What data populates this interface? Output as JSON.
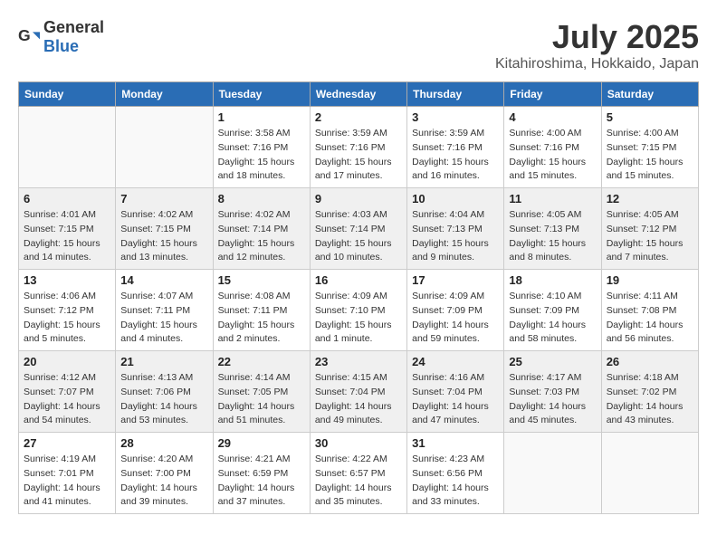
{
  "header": {
    "logo_general": "General",
    "logo_blue": "Blue",
    "month_title": "July 2025",
    "location": "Kitahiroshima, Hokkaido, Japan"
  },
  "weekdays": [
    "Sunday",
    "Monday",
    "Tuesday",
    "Wednesday",
    "Thursday",
    "Friday",
    "Saturday"
  ],
  "weeks": [
    [
      {
        "day": "",
        "detail": ""
      },
      {
        "day": "",
        "detail": ""
      },
      {
        "day": "1",
        "detail": "Sunrise: 3:58 AM\nSunset: 7:16 PM\nDaylight: 15 hours\nand 18 minutes."
      },
      {
        "day": "2",
        "detail": "Sunrise: 3:59 AM\nSunset: 7:16 PM\nDaylight: 15 hours\nand 17 minutes."
      },
      {
        "day": "3",
        "detail": "Sunrise: 3:59 AM\nSunset: 7:16 PM\nDaylight: 15 hours\nand 16 minutes."
      },
      {
        "day": "4",
        "detail": "Sunrise: 4:00 AM\nSunset: 7:16 PM\nDaylight: 15 hours\nand 15 minutes."
      },
      {
        "day": "5",
        "detail": "Sunrise: 4:00 AM\nSunset: 7:15 PM\nDaylight: 15 hours\nand 15 minutes."
      }
    ],
    [
      {
        "day": "6",
        "detail": "Sunrise: 4:01 AM\nSunset: 7:15 PM\nDaylight: 15 hours\nand 14 minutes."
      },
      {
        "day": "7",
        "detail": "Sunrise: 4:02 AM\nSunset: 7:15 PM\nDaylight: 15 hours\nand 13 minutes."
      },
      {
        "day": "8",
        "detail": "Sunrise: 4:02 AM\nSunset: 7:14 PM\nDaylight: 15 hours\nand 12 minutes."
      },
      {
        "day": "9",
        "detail": "Sunrise: 4:03 AM\nSunset: 7:14 PM\nDaylight: 15 hours\nand 10 minutes."
      },
      {
        "day": "10",
        "detail": "Sunrise: 4:04 AM\nSunset: 7:13 PM\nDaylight: 15 hours\nand 9 minutes."
      },
      {
        "day": "11",
        "detail": "Sunrise: 4:05 AM\nSunset: 7:13 PM\nDaylight: 15 hours\nand 8 minutes."
      },
      {
        "day": "12",
        "detail": "Sunrise: 4:05 AM\nSunset: 7:12 PM\nDaylight: 15 hours\nand 7 minutes."
      }
    ],
    [
      {
        "day": "13",
        "detail": "Sunrise: 4:06 AM\nSunset: 7:12 PM\nDaylight: 15 hours\nand 5 minutes."
      },
      {
        "day": "14",
        "detail": "Sunrise: 4:07 AM\nSunset: 7:11 PM\nDaylight: 15 hours\nand 4 minutes."
      },
      {
        "day": "15",
        "detail": "Sunrise: 4:08 AM\nSunset: 7:11 PM\nDaylight: 15 hours\nand 2 minutes."
      },
      {
        "day": "16",
        "detail": "Sunrise: 4:09 AM\nSunset: 7:10 PM\nDaylight: 15 hours\nand 1 minute."
      },
      {
        "day": "17",
        "detail": "Sunrise: 4:09 AM\nSunset: 7:09 PM\nDaylight: 14 hours\nand 59 minutes."
      },
      {
        "day": "18",
        "detail": "Sunrise: 4:10 AM\nSunset: 7:09 PM\nDaylight: 14 hours\nand 58 minutes."
      },
      {
        "day": "19",
        "detail": "Sunrise: 4:11 AM\nSunset: 7:08 PM\nDaylight: 14 hours\nand 56 minutes."
      }
    ],
    [
      {
        "day": "20",
        "detail": "Sunrise: 4:12 AM\nSunset: 7:07 PM\nDaylight: 14 hours\nand 54 minutes."
      },
      {
        "day": "21",
        "detail": "Sunrise: 4:13 AM\nSunset: 7:06 PM\nDaylight: 14 hours\nand 53 minutes."
      },
      {
        "day": "22",
        "detail": "Sunrise: 4:14 AM\nSunset: 7:05 PM\nDaylight: 14 hours\nand 51 minutes."
      },
      {
        "day": "23",
        "detail": "Sunrise: 4:15 AM\nSunset: 7:04 PM\nDaylight: 14 hours\nand 49 minutes."
      },
      {
        "day": "24",
        "detail": "Sunrise: 4:16 AM\nSunset: 7:04 PM\nDaylight: 14 hours\nand 47 minutes."
      },
      {
        "day": "25",
        "detail": "Sunrise: 4:17 AM\nSunset: 7:03 PM\nDaylight: 14 hours\nand 45 minutes."
      },
      {
        "day": "26",
        "detail": "Sunrise: 4:18 AM\nSunset: 7:02 PM\nDaylight: 14 hours\nand 43 minutes."
      }
    ],
    [
      {
        "day": "27",
        "detail": "Sunrise: 4:19 AM\nSunset: 7:01 PM\nDaylight: 14 hours\nand 41 minutes."
      },
      {
        "day": "28",
        "detail": "Sunrise: 4:20 AM\nSunset: 7:00 PM\nDaylight: 14 hours\nand 39 minutes."
      },
      {
        "day": "29",
        "detail": "Sunrise: 4:21 AM\nSunset: 6:59 PM\nDaylight: 14 hours\nand 37 minutes."
      },
      {
        "day": "30",
        "detail": "Sunrise: 4:22 AM\nSunset: 6:57 PM\nDaylight: 14 hours\nand 35 minutes."
      },
      {
        "day": "31",
        "detail": "Sunrise: 4:23 AM\nSunset: 6:56 PM\nDaylight: 14 hours\nand 33 minutes."
      },
      {
        "day": "",
        "detail": ""
      },
      {
        "day": "",
        "detail": ""
      }
    ]
  ]
}
